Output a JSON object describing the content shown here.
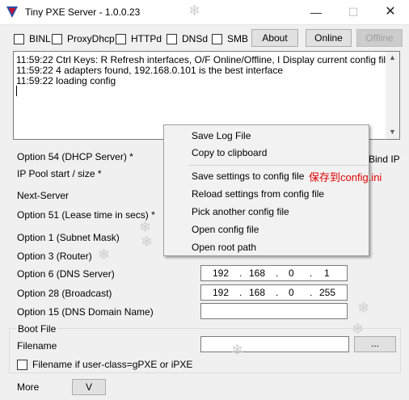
{
  "window": {
    "title": "Tiny PXE Server - 1.0.0.23",
    "minimize_glyph": "—",
    "maximize_glyph": "☐",
    "close_glyph": "✕"
  },
  "decor": {
    "snowflake": "❄"
  },
  "services": [
    {
      "label": "BINL",
      "checked": false
    },
    {
      "label": "ProxyDhcp",
      "checked": false
    },
    {
      "label": "HTTPd",
      "checked": false
    },
    {
      "label": "DNSd",
      "checked": false
    },
    {
      "label": "SMB",
      "checked": false
    }
  ],
  "toolbar": {
    "about": "About",
    "online": "Online",
    "offline": "Offline"
  },
  "log": {
    "lines": [
      "11:59:22 Ctrl Keys: R Refresh interfaces, O/F Online/Offline, I Display current config filename",
      "11:59:22 4 adapters found, 192.168.0.101 is the best interface",
      "11:59:22 loading config"
    ]
  },
  "options": {
    "opt54": "Option 54 (DHCP Server) *",
    "pool": "IP Pool start / size *",
    "next_server": "Next-Server",
    "opt51": "Option 51 (Lease time in secs) *",
    "opt1": "Option 1  (Subnet Mask)",
    "opt3": "Option 3  (Router)",
    "opt6": "Option 6  (DNS Server)",
    "opt28": "Option 28 (Broadcast)",
    "opt15": "Option 15 (DNS Domain Name)",
    "bind_ip": "Bind IP"
  },
  "dns_server": [
    "192",
    "168",
    "0",
    "1"
  ],
  "broadcast": [
    "192",
    "168",
    "0",
    "255"
  ],
  "ip_dot": ".",
  "boot": {
    "group": "Boot File",
    "filename_label": "Filename",
    "browse": "...",
    "userclass_label": "Filename if user-class=gPXE or iPXE",
    "userclass_checked": false
  },
  "more": {
    "label": "More",
    "button": "V"
  },
  "context_menu": {
    "items": [
      "Save Log File",
      "Copy to clipboard",
      "Save settings to config file",
      "Reload settings from config file",
      "Pick another config file",
      "Open config file",
      "Open root path"
    ]
  },
  "annotation": {
    "text": "保存到config.ini",
    "color": "#e00000"
  },
  "colors": {
    "icon_blue": "#2a4fa8",
    "icon_red": "#c8102e"
  }
}
